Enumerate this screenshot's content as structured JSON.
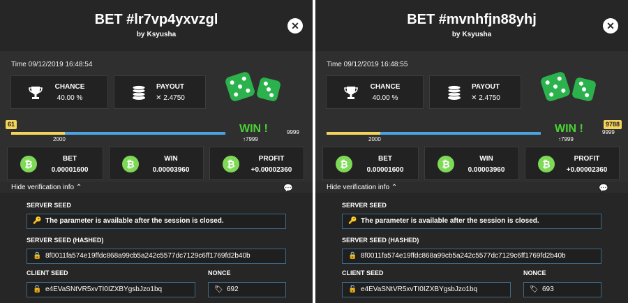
{
  "panels": [
    {
      "title": "BET #lr7vp4yxvzgl",
      "by_label": "by",
      "author": "Ksyusha",
      "time": "Time 09/12/2019 16:48:54",
      "chance_label": "CHANCE",
      "chance_value": "40.00 %",
      "payout_label": "PAYOUT",
      "payout_value": "✕ 2.4750",
      "roll_value": "61",
      "tick_2000": "2000",
      "tick_7999": "7999",
      "tick_9999": "9999",
      "win_text": "WIN !",
      "bet_label": "BET",
      "bet_value": "0.00001600",
      "win_label": "WIN",
      "win_value": "0.00003960",
      "profit_label": "PROFIT",
      "profit_value": "+0.00002360",
      "hide_verification": "Hide verification info",
      "server_seed_label": "SERVER SEED",
      "server_seed_value": "The parameter is available after the session is closed.",
      "server_seed_hashed_label": "SERVER SEED (HASHED)",
      "server_seed_hashed_value": "8f0011fa574e19ffdc868a99cb5a242c5577dc7129c6ff1769fd2b40b",
      "client_seed_label": "CLIENT SEED",
      "client_seed_value": "e4EVaSNtVR5xvTI0IZXBYgsbJzo1bq",
      "nonce_label": "NONCE",
      "nonce_value": "692",
      "roll_fraction": 0.0061
    },
    {
      "title": "BET #mvnhfjn88yhj",
      "by_label": "by",
      "author": "Ksyusha",
      "time": "Time 09/12/2019 16:48:55",
      "chance_label": "CHANCE",
      "chance_value": "40.00 %",
      "payout_label": "PAYOUT",
      "payout_value": "✕ 2.4750",
      "roll_value": "9788",
      "tick_2000": "2000",
      "tick_7999": "7999",
      "tick_9999": "9999",
      "win_text": "WIN !",
      "bet_label": "BET",
      "bet_value": "0.00001600",
      "win_label": "WIN",
      "win_value": "0.00003960",
      "profit_label": "PROFIT",
      "profit_value": "+0.00002360",
      "hide_verification": "Hide verification info",
      "server_seed_label": "SERVER SEED",
      "server_seed_value": "The parameter is available after the session is closed.",
      "server_seed_hashed_label": "SERVER SEED (HASHED)",
      "server_seed_hashed_value": "8f0011fa574e19ffdc868a99cb5a242c5577dc7129c6ff1769fd2b40b",
      "client_seed_label": "CLIENT SEED",
      "client_seed_value": "e4EVaSNtVR5xvTI0IZXBYgsbJzo1bq",
      "nonce_label": "NONCE",
      "nonce_value": "693",
      "roll_fraction": 0.9788
    }
  ],
  "colors": {
    "accent_green": "#4cd137",
    "btc_green": "#7ed957",
    "dice_green": "#2bb24c",
    "range_yellow": "#f3d35a",
    "range_blue": "#4aa3df",
    "field_border": "#3d6b8a"
  },
  "icons": {
    "close": "close-icon",
    "chance": "trophy-icon",
    "payout": "coins-icon",
    "dice": "dice-icon",
    "currency": "bitcoin-icon",
    "key": "key-icon",
    "lock": "lock-icon",
    "unlock": "unlock-icon",
    "tag": "tag-icon",
    "chat": "chat-icon"
  }
}
